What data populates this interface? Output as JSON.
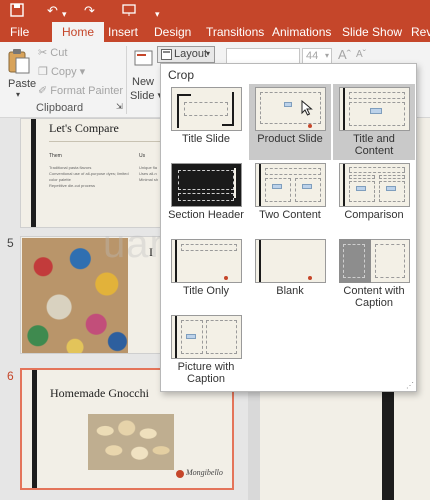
{
  "ribbon": {
    "tabs": [
      {
        "label": "File"
      },
      {
        "label": "Home",
        "active": true
      },
      {
        "label": "Insert"
      },
      {
        "label": "Design"
      },
      {
        "label": "Transitions"
      },
      {
        "label": "Animations"
      },
      {
        "label": "Slide Show"
      },
      {
        "label": "Revi"
      }
    ],
    "clipboard": {
      "paste_label": "Paste",
      "cut_label": "Cut",
      "copy_label": "Copy",
      "format_painter_label": "Format Painter",
      "group_label": "Clipboard"
    },
    "slides_group": {
      "new_label": "New",
      "slide_label": "Slide"
    },
    "layout_label": "Layout",
    "font_size": "44"
  },
  "thumbnails": [
    {
      "title": "Let's Compare",
      "col1_heading": "Them",
      "col1_items": [
        "Traditional pasta flavors",
        "Conventional use of all-purpose dyes; limited color palette",
        "Repetitive die-cut process"
      ],
      "col2_heading": "Us",
      "col2_items": [
        "Unique fla",
        "Uses all-n",
        "Minimal sh"
      ]
    },
    {
      "number": "5",
      "title": "I"
    },
    {
      "number": "6",
      "title": "Homemade Gnocchi",
      "logo_text": "Mongibello"
    }
  ],
  "dropdown": {
    "header": "Crop",
    "layouts": [
      {
        "label": "Title Slide"
      },
      {
        "label": "Product Slide"
      },
      {
        "label": "Title and Content"
      },
      {
        "label": "Section Header"
      },
      {
        "label": "Two Content"
      },
      {
        "label": "Comparison"
      },
      {
        "label": "Title Only"
      },
      {
        "label": "Blank"
      },
      {
        "label": "Content with Caption"
      },
      {
        "label": "Picture with Caption"
      }
    ]
  },
  "watermark": "uantrimang",
  "colors": {
    "accent": "#c5462a",
    "selection": "#e4745a"
  }
}
